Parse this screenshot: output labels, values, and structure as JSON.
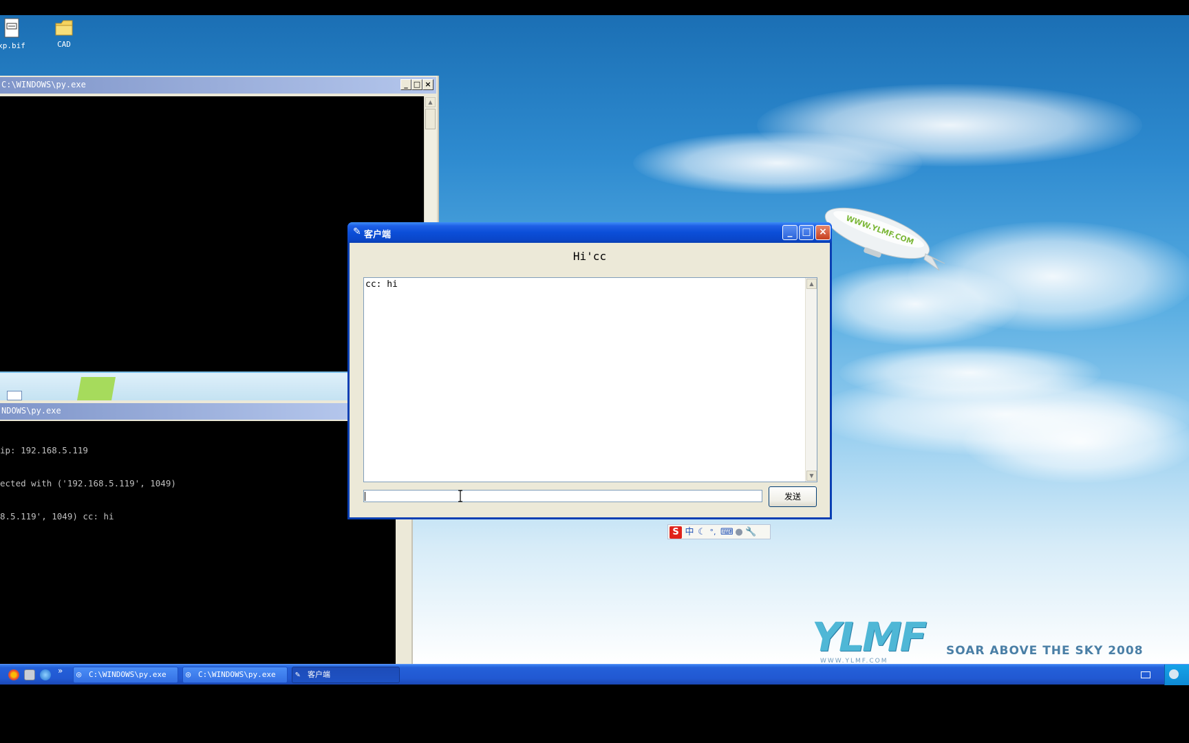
{
  "desktop": {
    "icons": [
      {
        "label": "xp.bif",
        "icon": "document-icon"
      },
      {
        "label": "CAD",
        "icon": "folder-icon"
      }
    ],
    "logo": {
      "brand": "YLMF",
      "tagline": "SOAR ABOVE THE SKY 2008",
      "url": "WWW.YLMF.COM"
    },
    "blimp_text": "WWW.YLMF.COM"
  },
  "console_top": {
    "title": "C:\\WINDOWS\\py.exe"
  },
  "console_bottom": {
    "title": "NDOWS\\py.exe",
    "lines": [
      "ip: 192.168.5.119",
      "ected with ('192.168.5.119', 1049)",
      "8.5.119', 1049) cc: hi"
    ]
  },
  "client_window": {
    "title": "客户端",
    "greeting": "Hi'cc",
    "chat_log": "cc: hi",
    "input_value": "",
    "send_label": "发送"
  },
  "ime_bar": {
    "logo": "S",
    "mode": "中",
    "punct": "°,"
  },
  "taskbar": {
    "buttons": [
      {
        "label": "C:\\WINDOWS\\py.exe"
      },
      {
        "label": "C:\\WINDOWS\\py.exe"
      },
      {
        "label": "客户端"
      }
    ],
    "overflow": "»"
  },
  "colors": {
    "xp_title_blue": "#0a46c9",
    "taskbar_blue": "#2158d2",
    "console_bg": "#000000",
    "dialog_bg": "#ece9d8"
  }
}
